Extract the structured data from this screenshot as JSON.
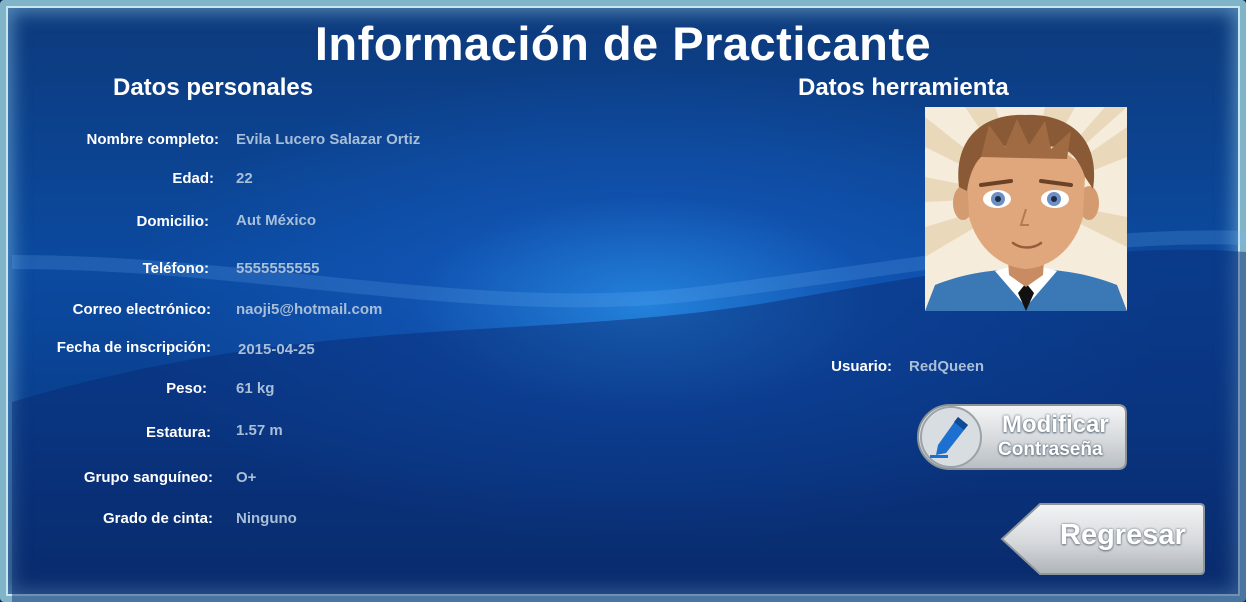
{
  "title": "Información de Practicante",
  "sections": {
    "personal": "Datos personales",
    "tool": "Datos herramienta"
  },
  "fields": {
    "nombre": {
      "label": "Nombre completo:",
      "value": "Evila Lucero Salazar Ortiz"
    },
    "edad": {
      "label": "Edad:",
      "value": "22"
    },
    "domicilio": {
      "label": "Domicilio:",
      "value": "Aut México"
    },
    "telefono": {
      "label": "Teléfono:",
      "value": "5555555555"
    },
    "correo": {
      "label": "Correo electrónico:",
      "value": "naoji5@hotmail.com"
    },
    "fecha": {
      "label": "Fecha de inscripción:",
      "value": "2015-04-25"
    },
    "peso": {
      "label": "Peso:",
      "value": "61 kg"
    },
    "estatura": {
      "label": "Estatura:",
      "value": "1.57 m"
    },
    "grupo": {
      "label": "Grupo sanguíneo:",
      "value": "O+"
    },
    "cinta": {
      "label": "Grado de cinta:",
      "value": "Ninguno"
    }
  },
  "usuario": {
    "label": "Usuario:",
    "value": "RedQueen"
  },
  "buttons": {
    "modify_line1": "Modificar",
    "modify_line2": "Contraseña",
    "back": "Regresar"
  },
  "icons": {
    "avatar": "boy-avatar-image",
    "modify": "pencil-icon",
    "back": "left-arrow-icon"
  },
  "colors": {
    "background": "#0b4aa0",
    "label": "#ffffff",
    "value": "#a9bfd8",
    "button": "#e6e8ea"
  }
}
